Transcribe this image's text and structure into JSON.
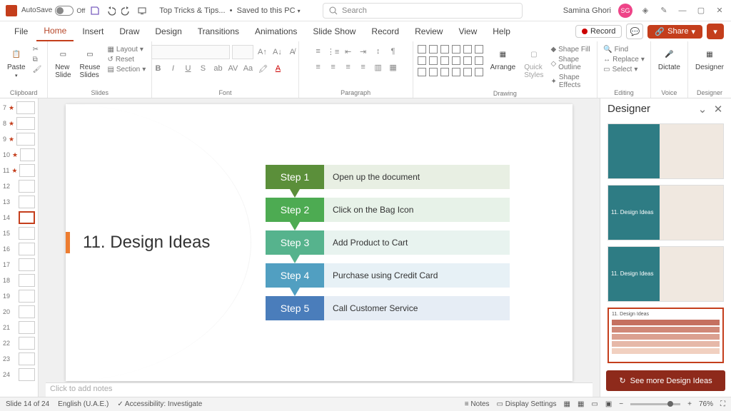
{
  "titlebar": {
    "autosave_label": "AutoSave",
    "autosave_state": "Off",
    "doc_name": "Top Tricks & Tips...",
    "save_state": "Saved to this PC",
    "search_placeholder": "Search",
    "user_name": "Samina Ghori",
    "user_initials": "SG"
  },
  "tabs": {
    "items": [
      "File",
      "Home",
      "Insert",
      "Draw",
      "Design",
      "Transitions",
      "Animations",
      "Slide Show",
      "Record",
      "Review",
      "View",
      "Help"
    ],
    "active": "Home",
    "record_btn": "Record",
    "share_btn": "Share"
  },
  "ribbon": {
    "clipboard": {
      "label": "Clipboard",
      "paste": "Paste"
    },
    "slides": {
      "label": "Slides",
      "new": "New\nSlide",
      "reuse": "Reuse\nSlides",
      "layout": "Layout",
      "reset": "Reset",
      "section": "Section"
    },
    "font": {
      "label": "Font"
    },
    "paragraph": {
      "label": "Paragraph"
    },
    "drawing": {
      "label": "Drawing",
      "arrange": "Arrange",
      "quick": "Quick\nStyles",
      "shape_fill": "Shape Fill",
      "shape_outline": "Shape Outline",
      "shape_effects": "Shape Effects"
    },
    "editing": {
      "label": "Editing",
      "find": "Find",
      "replace": "Replace",
      "select": "Select"
    },
    "voice": {
      "label": "Voice",
      "dictate": "Dictate"
    },
    "designer_btn": {
      "label": "Designer",
      "btn": "Designer"
    }
  },
  "thumbnails": {
    "visible_start": 7,
    "visible_end": 24,
    "selected": 14,
    "with_animation": [
      7,
      8,
      9,
      10,
      11
    ]
  },
  "slide": {
    "title": "11. Design Ideas",
    "steps": [
      {
        "label": "Step 1",
        "text": "Open up the document",
        "label_color": "#5b8f3a",
        "body_color": "#e8efe3"
      },
      {
        "label": "Step 2",
        "text": "Click on the Bag Icon",
        "label_color": "#4dab52",
        "body_color": "#e7f2e8"
      },
      {
        "label": "Step 3",
        "text": "Add Product to Cart",
        "label_color": "#56b38d",
        "body_color": "#e8f3ef"
      },
      {
        "label": "Step 4",
        "text": "Purchase using Credit Card",
        "label_color": "#519fc1",
        "body_color": "#e7f1f6"
      },
      {
        "label": "Step 5",
        "text": "Call Customer Service",
        "label_color": "#4a7dbb",
        "body_color": "#e6edf5"
      }
    ]
  },
  "notes_placeholder": "Click to add notes",
  "designer": {
    "title": "Designer",
    "see_more": "See more Design Ideas",
    "opts": [
      {
        "text": ""
      },
      {
        "text": "11. Design Ideas"
      },
      {
        "text": "11. Design Ideas"
      },
      {
        "text": "11. Design Ideas"
      }
    ],
    "selected": 3
  },
  "statusbar": {
    "slide_counter": "Slide 14 of 24",
    "language": "English (U.A.E.)",
    "accessibility": "Accessibility: Investigate",
    "notes": "Notes",
    "display": "Display Settings",
    "zoom": "76%"
  }
}
